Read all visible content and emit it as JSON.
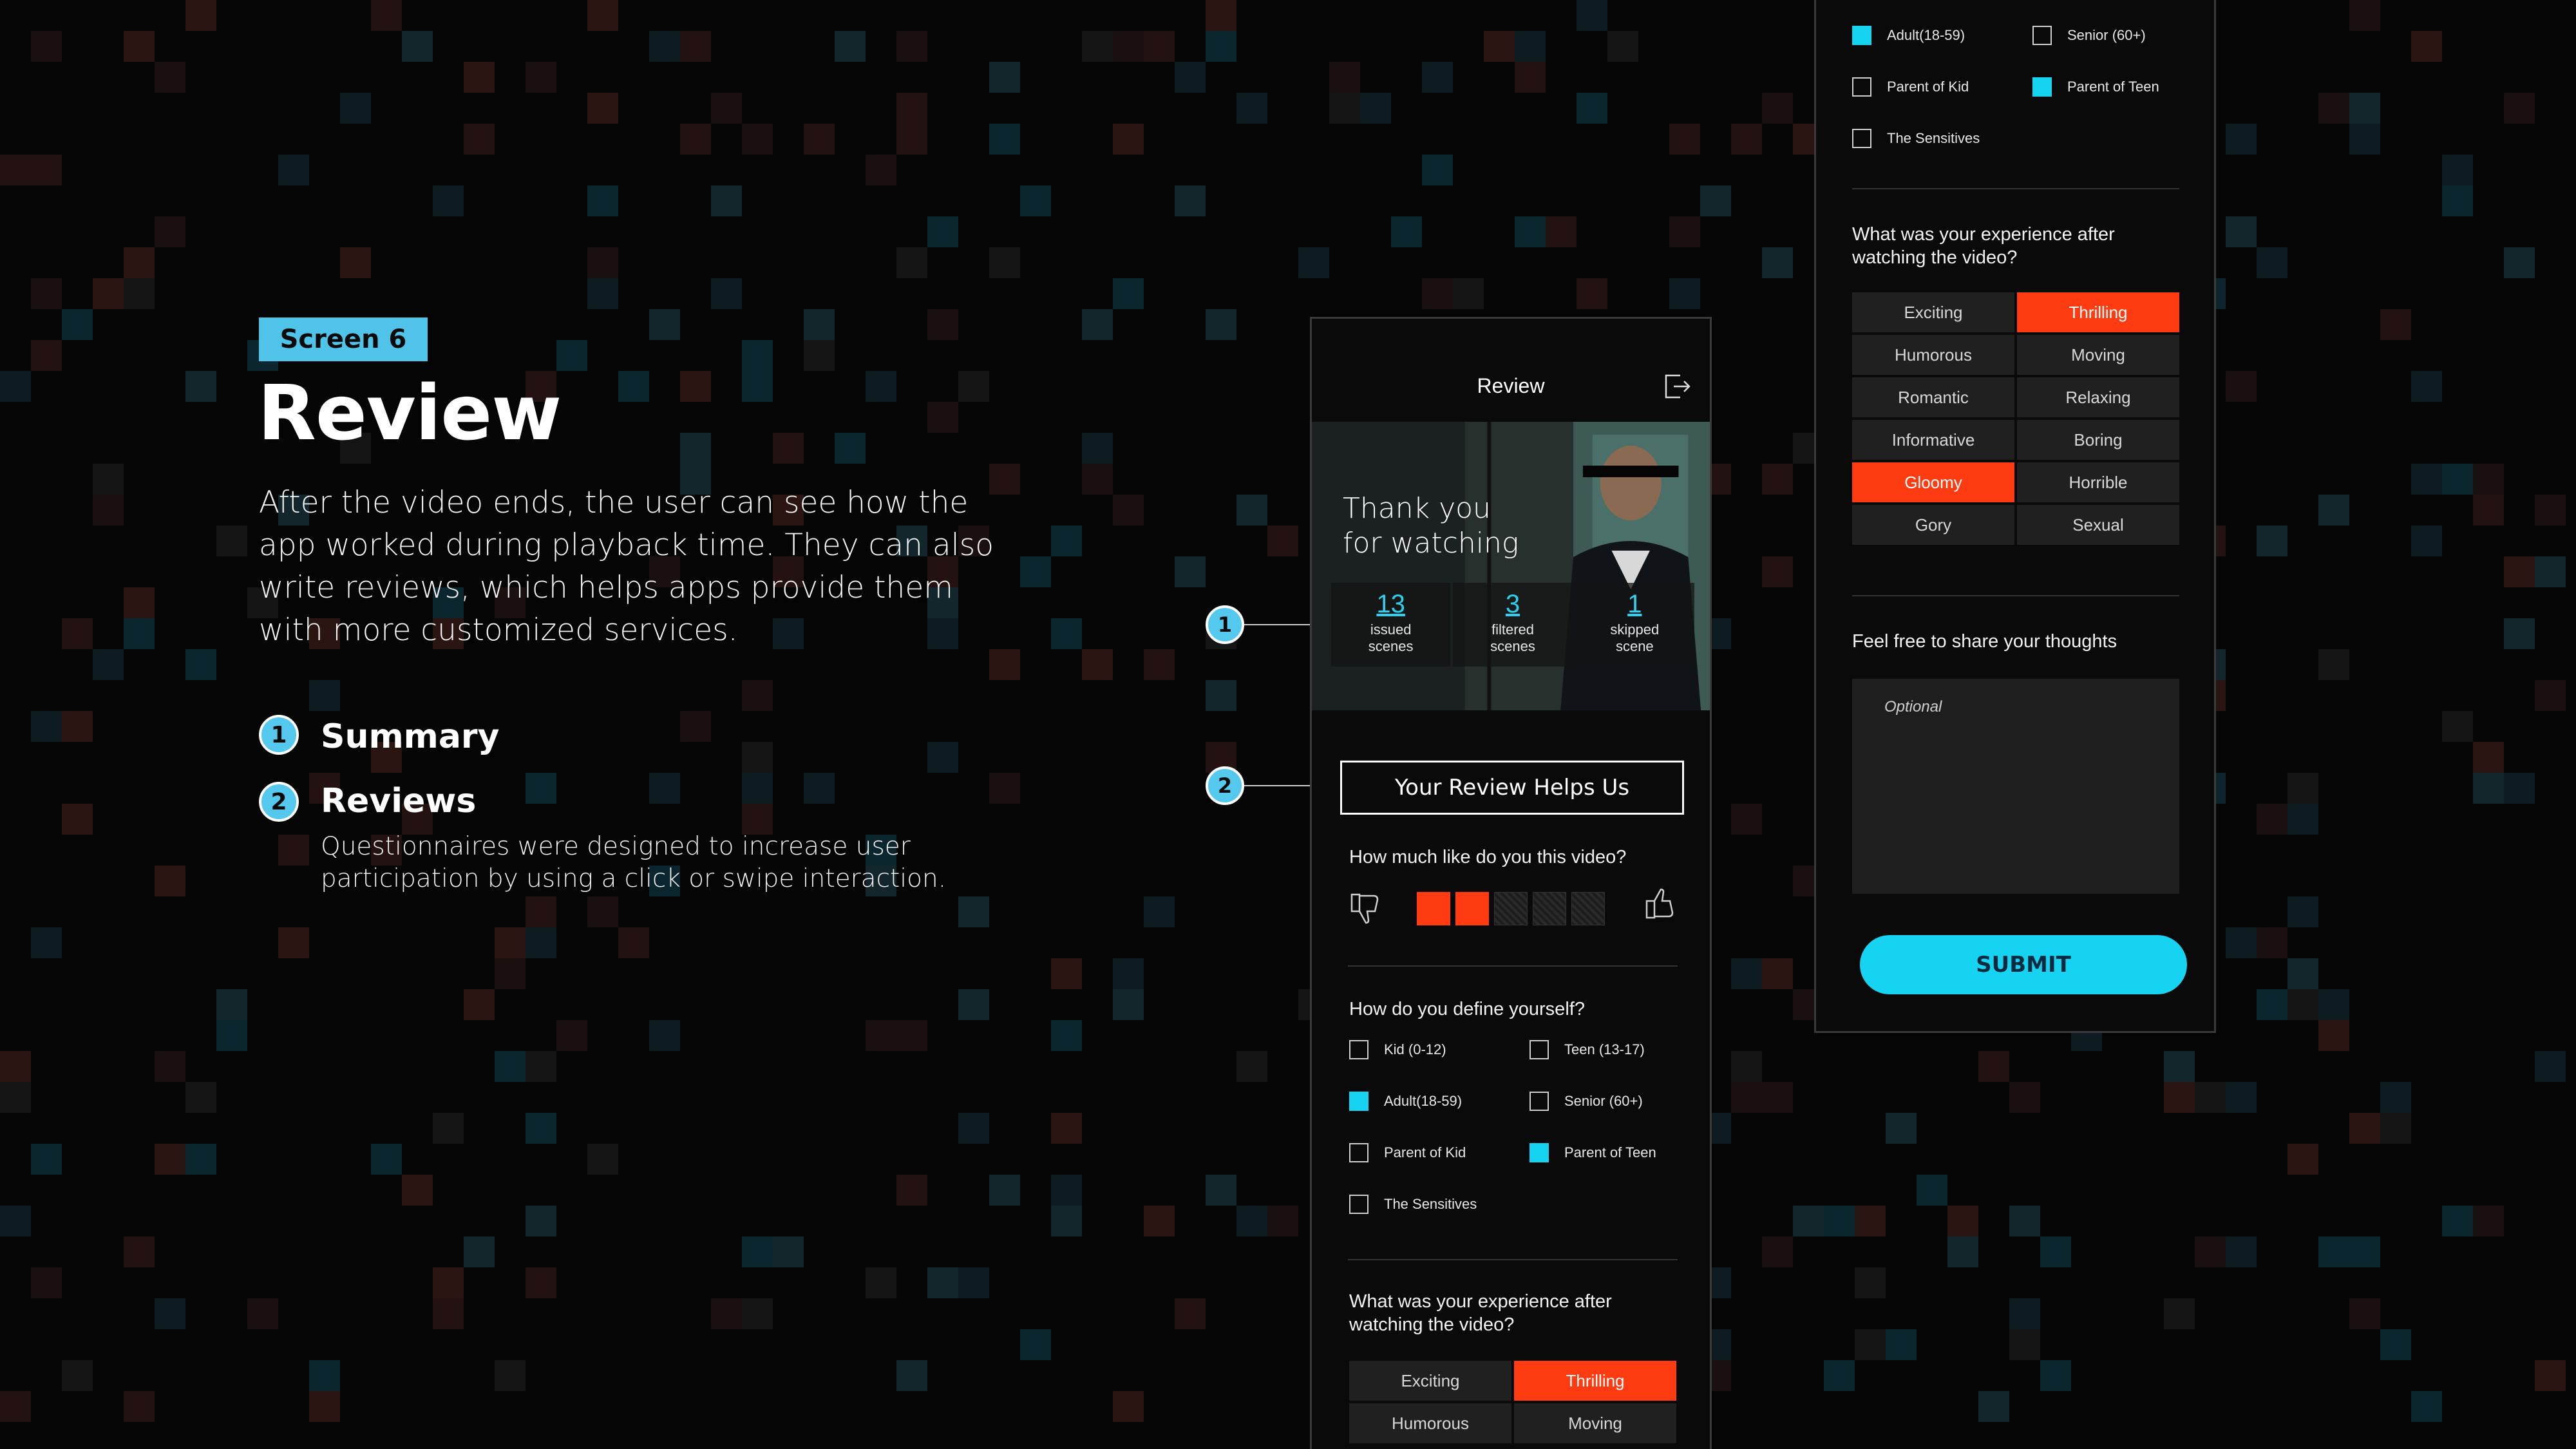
{
  "colors": {
    "accent_cyan": "#17d3f2",
    "badge_blue": "#4fc3e8",
    "selected_red": "#ff3b12",
    "background": "#050505"
  },
  "intro": {
    "screen_tag": "Screen 6",
    "title": "Review",
    "description": "After the video ends, the user can see how the app worked during playback time. They can also write reviews, which helps apps provide them with more customized services.",
    "items": [
      {
        "number": "1",
        "label": "Summary"
      },
      {
        "number": "2",
        "label": "Reviews",
        "sub": "Questionnaires were designed to increase user participation by using a click or swipe interaction."
      }
    ]
  },
  "callouts": [
    "1",
    "2"
  ],
  "phone1": {
    "header_title": "Review",
    "exit_icon": "exit-icon",
    "hero_text_line1": "Thank you",
    "hero_text_line2": "for watching",
    "stats": [
      {
        "value": "13",
        "label_line1": "issued",
        "label_line2": "scenes"
      },
      {
        "value": "3",
        "label_line1": "filtered",
        "label_line2": "scenes"
      },
      {
        "value": "1",
        "label_line1": "skipped",
        "label_line2": "scene"
      }
    ],
    "review_button": "Your Review Helps Us",
    "q1": "How much like do you this video?",
    "rating": {
      "filled": 2,
      "total": 5
    },
    "q2": "How do you define yourself?",
    "identity_options": [
      {
        "label": "Kid (0-12)",
        "checked": false
      },
      {
        "label": "Teen (13-17)",
        "checked": false
      },
      {
        "label": "Adult(18-59)",
        "checked": true
      },
      {
        "label": "Senior (60+)",
        "checked": false
      },
      {
        "label": "Parent of Kid",
        "checked": false
      },
      {
        "label": "Parent of Teen",
        "checked": true
      },
      {
        "label": "The Sensitives",
        "checked": false
      }
    ],
    "q3_line1": "What was your experience after",
    "q3_line2": "watching the video?",
    "experience_visible": [
      {
        "label": "Exciting",
        "selected": false
      },
      {
        "label": "Thrilling",
        "selected": true
      },
      {
        "label": "Humorous",
        "selected": false
      },
      {
        "label": "Moving",
        "selected": false
      }
    ]
  },
  "phone2": {
    "identity_options": [
      {
        "label": "Adult(18-59)",
        "checked": true
      },
      {
        "label": "Senior (60+)",
        "checked": false
      },
      {
        "label": "Parent of Kid",
        "checked": false
      },
      {
        "label": "Parent of Teen",
        "checked": true
      },
      {
        "label": "The Sensitives",
        "checked": false
      }
    ],
    "q3_line1": "What was your experience after",
    "q3_line2": "watching the video?",
    "experience": [
      {
        "label": "Exciting",
        "selected": false
      },
      {
        "label": "Thrilling",
        "selected": true
      },
      {
        "label": "Humorous",
        "selected": false
      },
      {
        "label": "Moving",
        "selected": false
      },
      {
        "label": "Romantic",
        "selected": false
      },
      {
        "label": "Relaxing",
        "selected": false
      },
      {
        "label": "Informative",
        "selected": false
      },
      {
        "label": "Boring",
        "selected": false
      },
      {
        "label": "Gloomy",
        "selected": true
      },
      {
        "label": "Horrible",
        "selected": false
      },
      {
        "label": "Gory",
        "selected": false
      },
      {
        "label": "Sexual",
        "selected": false
      }
    ],
    "q4": "Feel free to share your thoughts",
    "thoughts_placeholder": "Optional",
    "submit": "SUBMIT"
  }
}
